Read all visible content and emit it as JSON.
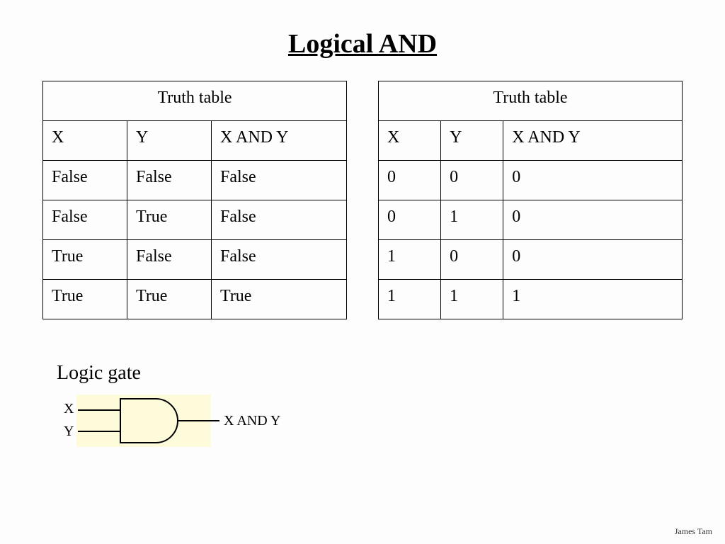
{
  "title": "Logical AND",
  "table_left": {
    "caption": "Truth table",
    "headers": [
      "X",
      "Y",
      "X AND Y"
    ],
    "rows": [
      [
        "False",
        "False",
        "False"
      ],
      [
        "False",
        "True",
        "False"
      ],
      [
        "True",
        "False",
        "False"
      ],
      [
        "True",
        "True",
        "True"
      ]
    ]
  },
  "table_right": {
    "caption": "Truth table",
    "headers": [
      "X",
      "Y",
      "X AND Y"
    ],
    "rows": [
      [
        "0",
        "0",
        "0"
      ],
      [
        "0",
        "1",
        "0"
      ],
      [
        "1",
        "0",
        "0"
      ],
      [
        "1",
        "1",
        "1"
      ]
    ]
  },
  "gate": {
    "section_label": "Logic gate",
    "input_top": "X",
    "input_bottom": "Y",
    "output": "X AND Y"
  },
  "footer": "James Tam"
}
